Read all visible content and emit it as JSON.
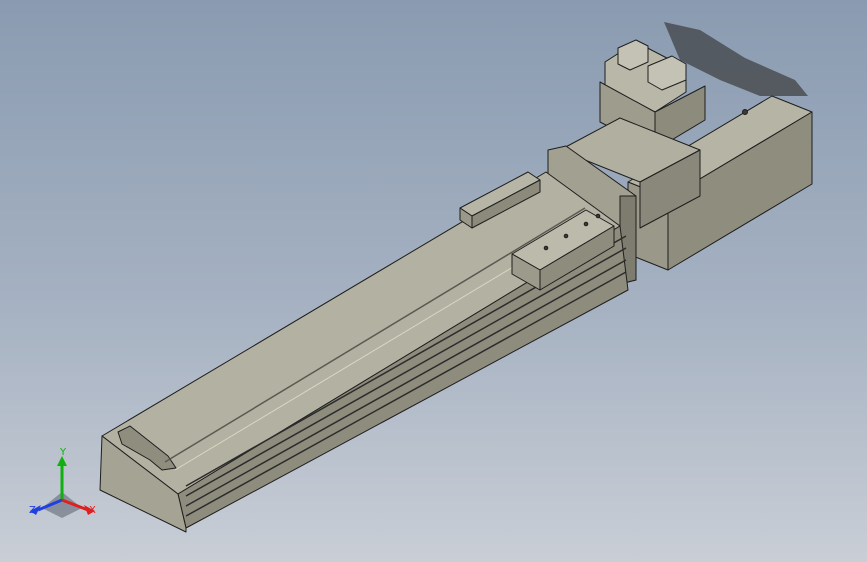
{
  "viewport": {
    "background_top": "#8a9bb1",
    "background_bottom": "#c9ced6"
  },
  "model": {
    "description_icon": "linear-actuator-3d-model",
    "body_color": "#a8a696",
    "shadow_color": "#4a4d52",
    "edge_color": "#1e1e1e"
  },
  "triad": {
    "x_label": "X",
    "y_label": "Y",
    "z_label": "Z",
    "x_color": "#e02020",
    "y_color": "#10b010",
    "z_color": "#2040e0"
  }
}
